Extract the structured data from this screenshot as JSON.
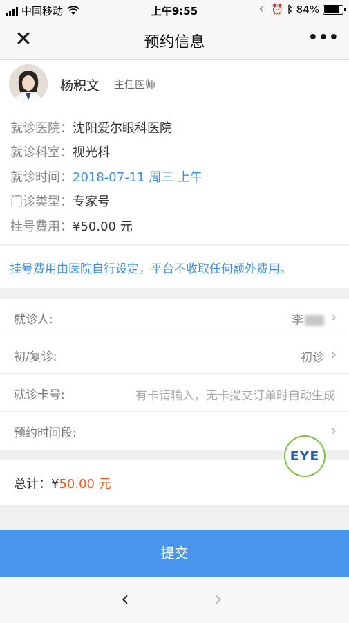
{
  "status_bar": {
    "carrier": "中国移动",
    "time": "上午9:55",
    "battery": "84%",
    "battery_level": 0.84,
    "icons": [
      "signal-icon",
      "wifi-icon",
      "moon-icon",
      "alarm-icon",
      "bluetooth-icon",
      "battery-icon"
    ]
  },
  "nav": {
    "title": "预约信息",
    "close_glyph": "✕",
    "more_glyph": "•••"
  },
  "doctor": {
    "name": "杨积文",
    "title": "主任医师",
    "info": [
      {
        "label": "就诊医院：",
        "value": "沈阳爱尔眼科医院"
      },
      {
        "label": "就诊科室：",
        "value": "视光科"
      },
      {
        "label": "就诊时间：",
        "value": "2018-07-11 周三 上午"
      },
      {
        "label": "门诊类型：",
        "value": "专家号"
      },
      {
        "label": "挂号费用：",
        "value": "¥50.00 元"
      }
    ]
  },
  "notice": "挂号费用由医院自行设定，平台不收取任何额外费用。",
  "form": {
    "patient_label": "就诊人:",
    "patient_value": "李",
    "visit_type_label": "初/复诊:",
    "visit_type_value": "初诊",
    "card_label": "就诊卡号:",
    "card_placeholder": "有卡请输入，无卡提交订单时自动生成",
    "slot_label": "预约时间段:"
  },
  "badge": "EYE",
  "total": {
    "label": "总计：",
    "currency": "¥",
    "amount": "50.00 元"
  },
  "submit_label": "提交",
  "colors": {
    "accent_blue": "#4a96ef",
    "link_blue": "#3f8ee6",
    "price_orange": "#f15a22"
  }
}
